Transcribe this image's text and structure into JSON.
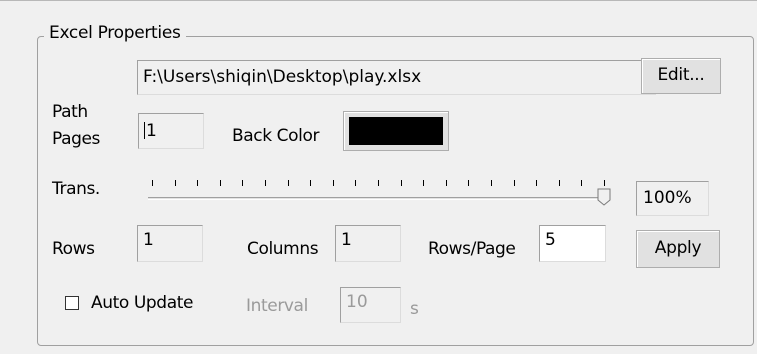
{
  "group": {
    "title": "Excel Properties"
  },
  "path": {
    "label": "Path",
    "value": "F:\\Users\\shiqin\\Desktop\\play.xlsx",
    "edit_label": "Edit..."
  },
  "pages": {
    "label": "Pages",
    "value": "1"
  },
  "back_color": {
    "label": "Back Color",
    "color": "#000000"
  },
  "trans": {
    "label": "Trans.",
    "value_percent": 100,
    "value_text": "100%"
  },
  "rows": {
    "label": "Rows",
    "value": "1"
  },
  "columns": {
    "label": "Columns",
    "value": "1"
  },
  "rows_per_page": {
    "label": "Rows/Page",
    "value": "5"
  },
  "apply_label": "Apply",
  "auto_update": {
    "label": "Auto Update",
    "checked": false
  },
  "interval": {
    "label": "Interval",
    "value": "10",
    "unit": "s"
  }
}
